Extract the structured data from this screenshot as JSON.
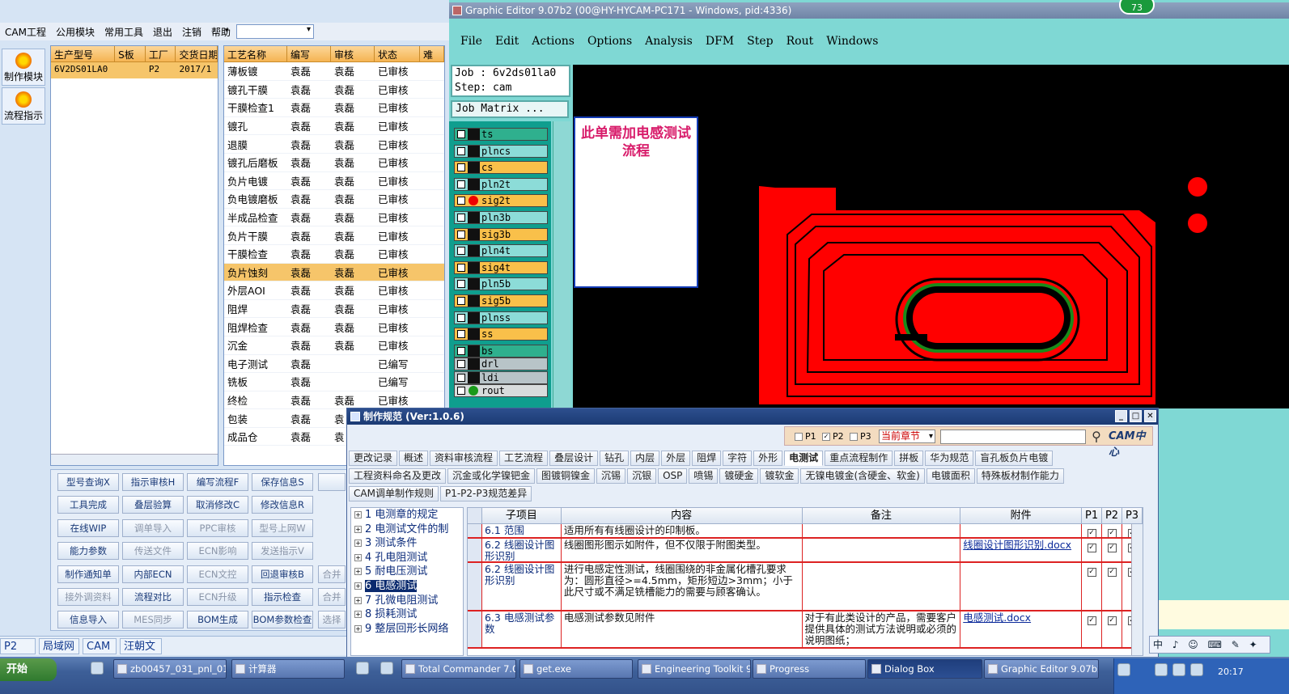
{
  "left_app": {
    "menu": [
      "CAM工程",
      "公用模块",
      "常用工具",
      "退出",
      "注销",
      "帮助"
    ],
    "menu_arrow": "▾",
    "side": [
      {
        "label": "制作模块",
        "icon": "wrench-icon"
      },
      {
        "label": "流程指示",
        "icon": "flow-icon"
      }
    ],
    "grid1": {
      "headers": [
        "生产型号",
        "S板",
        "工厂",
        "交货日期"
      ],
      "row": {
        "model": "6V2DS01LA0",
        "s": "",
        "factory": "P2",
        "date": "2017/1"
      }
    },
    "grid2": {
      "headers": [
        "工艺名称",
        "编写",
        "审核",
        "状态",
        "难"
      ],
      "rows": [
        {
          "name": "薄板镀",
          "writer": "袁磊",
          "reviewer": "袁磊",
          "status": "已审核"
        },
        {
          "name": "镀孔干膜",
          "writer": "袁磊",
          "reviewer": "袁磊",
          "status": "已审核"
        },
        {
          "name": "干膜检查1",
          "writer": "袁磊",
          "reviewer": "袁磊",
          "status": "已审核"
        },
        {
          "name": "镀孔",
          "writer": "袁磊",
          "reviewer": "袁磊",
          "status": "已审核"
        },
        {
          "name": "退膜",
          "writer": "袁磊",
          "reviewer": "袁磊",
          "status": "已审核"
        },
        {
          "name": "镀孔后磨板",
          "writer": "袁磊",
          "reviewer": "袁磊",
          "status": "已审核"
        },
        {
          "name": "负片电镀",
          "writer": "袁磊",
          "reviewer": "袁磊",
          "status": "已审核"
        },
        {
          "name": "负电镀磨板",
          "writer": "袁磊",
          "reviewer": "袁磊",
          "status": "已审核"
        },
        {
          "name": "半成品检查",
          "writer": "袁磊",
          "reviewer": "袁磊",
          "status": "已审核"
        },
        {
          "name": "负片干膜",
          "writer": "袁磊",
          "reviewer": "袁磊",
          "status": "已审核"
        },
        {
          "name": "干膜检查",
          "writer": "袁磊",
          "reviewer": "袁磊",
          "status": "已审核"
        },
        {
          "name": "负片蚀刻",
          "writer": "袁磊",
          "reviewer": "袁磊",
          "status": "已审核"
        },
        {
          "name": "外层AOI",
          "writer": "袁磊",
          "reviewer": "袁磊",
          "status": "已审核"
        },
        {
          "name": "阻焊",
          "writer": "袁磊",
          "reviewer": "袁磊",
          "status": "已审核"
        },
        {
          "name": "阻焊检查",
          "writer": "袁磊",
          "reviewer": "袁磊",
          "status": "已审核"
        },
        {
          "name": "沉金",
          "writer": "袁磊",
          "reviewer": "袁磊",
          "status": "已审核"
        },
        {
          "name": "电子测试",
          "writer": "袁磊",
          "reviewer": "",
          "status": "已编写"
        },
        {
          "name": "铣板",
          "writer": "袁磊",
          "reviewer": "",
          "status": "已编写"
        },
        {
          "name": "终检",
          "writer": "袁磊",
          "reviewer": "袁磊",
          "status": "已审核"
        },
        {
          "name": "包装",
          "writer": "袁磊",
          "reviewer": "袁",
          "status": ""
        },
        {
          "name": "成品仓",
          "writer": "袁磊",
          "reviewer": "袁",
          "status": ""
        }
      ]
    },
    "buttons": [
      [
        "型号查询X",
        "指示审核H",
        "编写流程F",
        "保存信息S"
      ],
      [
        "工具完成",
        "叠层验算",
        "取消修改C",
        "修改信息R"
      ],
      [
        "在线WIP",
        "调单导入",
        "PPC审核",
        "型号上网W"
      ],
      [
        "能力参数",
        "传送文件",
        "ECN影响",
        "发送指示V"
      ],
      [
        "制作通知单",
        "内部ECN",
        "ECN文控",
        "回退审核B"
      ],
      [
        "接外调资料",
        "流程对比",
        "ECN升级",
        "指示检查"
      ],
      [
        "信息导入",
        "MES同步",
        "BOM生成",
        "BOM参数检查"
      ]
    ],
    "buttons_extra": [
      "合并",
      "合并",
      "选择"
    ],
    "status": [
      "P2",
      "局域网",
      "CAM",
      "汪朝文"
    ]
  },
  "graphic_editor": {
    "title": "Graphic Editor 9.07b2 (00@HY-HYCAM-PC171 - Windows, pid:4336)",
    "badge": "73",
    "menu": [
      "File",
      "Edit",
      "Actions",
      "Options",
      "Analysis",
      "DFM",
      "Step",
      "Rout",
      "Windows"
    ],
    "job": "Job : 6v2ds01la0",
    "step": "Step: cam",
    "job_matrix": "Job Matrix ...",
    "layers": [
      {
        "name": "ts",
        "color": "#2fb08e"
      },
      {
        "name": "plncs",
        "color": "#8cdcd8"
      },
      {
        "name": "cs",
        "color": "#f9c04a"
      },
      {
        "name": "pln2t",
        "color": "#8cdcd8"
      },
      {
        "name": "sig2t",
        "color": "#f9c04a"
      },
      {
        "name": "pln3b",
        "color": "#8cdcd8"
      },
      {
        "name": "sig3b",
        "color": "#f9c04a"
      },
      {
        "name": "pln4t",
        "color": "#8cdcd8"
      },
      {
        "name": "sig4t",
        "color": "#f9c04a"
      },
      {
        "name": "pln5b",
        "color": "#8cdcd8"
      },
      {
        "name": "sig5b",
        "color": "#f9c04a"
      },
      {
        "name": "plnss",
        "color": "#8cdcd8"
      },
      {
        "name": "ss",
        "color": "#f9c04a"
      },
      {
        "name": "bs",
        "color": "#2fb08e"
      },
      {
        "name": "drl",
        "color": "#b8c4c8"
      },
      {
        "name": "ldi",
        "color": "#b8c4c8"
      },
      {
        "name": "rout",
        "color": "#d8dcdc"
      }
    ],
    "note": "此单需加电感测试流程"
  },
  "dialog": {
    "title": "制作规范 (Ver:1.0.6)",
    "filters": {
      "p1": "P1",
      "p2": "P2",
      "p3": "P3",
      "chapter": "当前章节",
      "search_value": ""
    },
    "logo": "CAM中心",
    "tabs_row1": [
      "更改记录",
      "概述",
      "资料审核流程",
      "工艺流程",
      "叠层设计",
      "钻孔",
      "内层",
      "外层",
      "阻焊",
      "字符",
      "外形",
      "电测试",
      "重点流程制作",
      "拼板",
      "华为规范",
      "盲孔板负片电镀"
    ],
    "tabs_row2": [
      "工程资料命名及更改",
      "沉金或化学镍钯金",
      "图镀铜镍金",
      "沉锡",
      "沉银",
      "OSP",
      "喷锡",
      "镀硬金",
      "镀软金",
      "无镍电镀金(含硬金、软金)",
      "电镀面积",
      "特殊板材制作能力"
    ],
    "tabs_row3": [
      "CAM调单制作规则",
      "P1-P2-P3规范差异"
    ],
    "active_tab": "电测试",
    "tree": [
      "1 电测章的规定",
      "2 电测试文件的制",
      "3 测试条件",
      "4 孔电阻测试",
      "5 耐电压测试",
      "6 电感测试",
      "7 孔微电阻测试",
      "8 损耗测试",
      "9 整层回形长网络"
    ],
    "columns": [
      "子项目",
      "内容",
      "备注",
      "附件",
      "P1",
      "P2",
      "P3"
    ],
    "rows": [
      {
        "item": "6.1 范围",
        "content": "适用所有有线圈设计的印制板。",
        "remark": "",
        "attachment": ""
      },
      {
        "item": "6.2 线圈设计图形识别",
        "content": "线圈图形图示如附件，但不仅限于附图类型。",
        "remark": "",
        "attachment": "线圈设计图形识别.docx"
      },
      {
        "item": "6.2 线圈设计图形识别",
        "content": "进行电感定性测试，线圈围绕的非金属化槽孔要求为：圆形直径>=4.5mm，矩形短边>3mm；小于此尺寸或不满足铣槽能力的需要与顾客确认。",
        "remark": "",
        "attachment": ""
      },
      {
        "item": "6.3 电感测试参数",
        "content": "电感测试参数见附件",
        "remark": "对于有此类设计的产品，需要客户提供具体的测试方法说明或必须的说明图纸；",
        "attachment": "电感测试.docx"
      }
    ],
    "check": "✓"
  },
  "ime": "中 ♪ ☺ ⌨ ✎ ✦",
  "taskbar": {
    "start": "开始",
    "items": [
      "zb00457_031_pnl_01...",
      "计算器",
      "Total Commander 7.0...",
      "get.exe",
      "Engineering Toolkit 9....",
      "Progress",
      "Dialog Box",
      "Graphic Editor 9.07b2..."
    ],
    "active": "Dialog Box",
    "clock": "20:17"
  }
}
